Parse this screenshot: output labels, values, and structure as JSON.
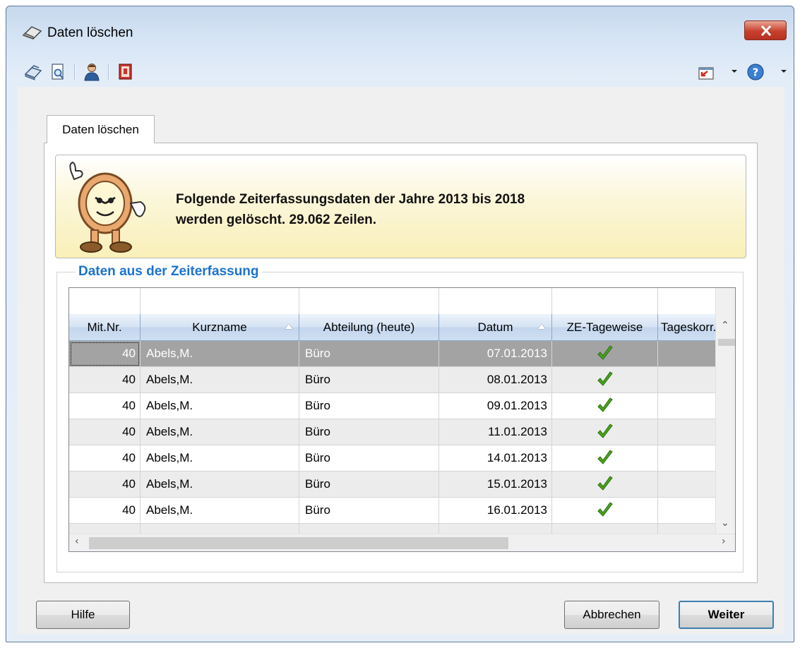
{
  "window": {
    "title": "Daten löschen"
  },
  "toolbar": {
    "icons": [
      "printer-icon",
      "print-preview-icon",
      "user-icon",
      "exit-icon",
      "import-icon",
      "help-icon"
    ]
  },
  "tab": {
    "label": "Daten löschen"
  },
  "info": {
    "line1": "Folgende Zeiterfassungsdaten der Jahre 2013 bis 2018",
    "line2": "werden gelöscht. 29.062 Zeilen."
  },
  "group": {
    "title": "Daten aus der Zeiterfassung"
  },
  "table": {
    "columns": [
      "Mit.Nr.",
      "Kurzname",
      "Abteilung (heute)",
      "Datum",
      "ZE-Tageweise",
      "Tageskorr."
    ],
    "rows": [
      {
        "nr": "40",
        "name": "Abels,M.",
        "abt": "Büro",
        "datum": "07.01.2013",
        "ze": true
      },
      {
        "nr": "40",
        "name": "Abels,M.",
        "abt": "Büro",
        "datum": "08.01.2013",
        "ze": true
      },
      {
        "nr": "40",
        "name": "Abels,M.",
        "abt": "Büro",
        "datum": "09.01.2013",
        "ze": true
      },
      {
        "nr": "40",
        "name": "Abels,M.",
        "abt": "Büro",
        "datum": "11.01.2013",
        "ze": true
      },
      {
        "nr": "40",
        "name": "Abels,M.",
        "abt": "Büro",
        "datum": "14.01.2013",
        "ze": true
      },
      {
        "nr": "40",
        "name": "Abels,M.",
        "abt": "Büro",
        "datum": "15.01.2013",
        "ze": true
      },
      {
        "nr": "40",
        "name": "Abels,M.",
        "abt": "Büro",
        "datum": "16.01.2013",
        "ze": true
      }
    ]
  },
  "buttons": {
    "help": "Hilfe",
    "cancel": "Abbrechen",
    "next": "Weiter"
  },
  "colors": {
    "accent": "#1b73cf",
    "selected_row": "#a3a3a3",
    "check": "#4aa51c"
  }
}
